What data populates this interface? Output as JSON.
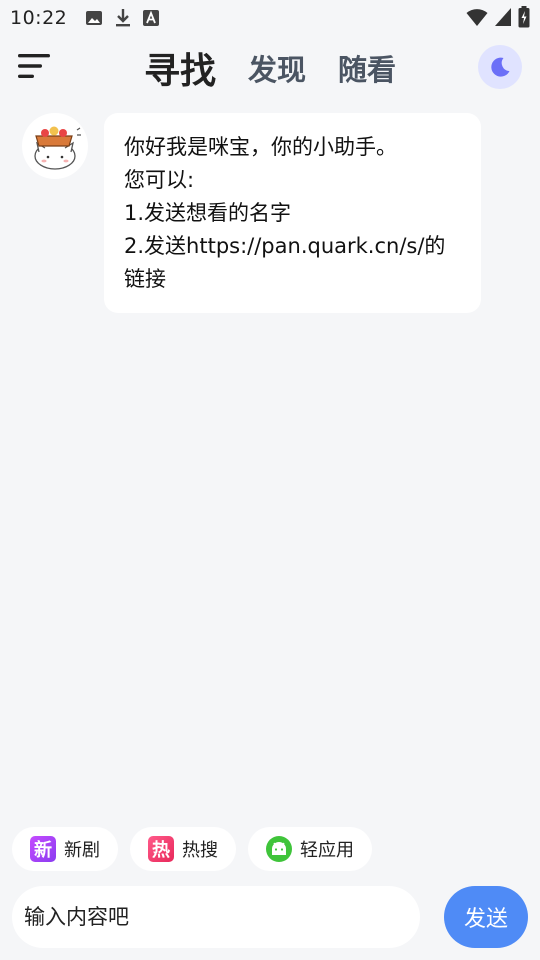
{
  "status_bar": {
    "time": "10:22",
    "left_icons": [
      "image-icon",
      "download-icon",
      "text-a-icon"
    ],
    "right_icons": [
      "wifi-icon",
      "signal-icon",
      "battery-icon"
    ]
  },
  "header": {
    "menu_icon": "menu-icon",
    "tabs": [
      {
        "label": "寻找",
        "active": true
      },
      {
        "label": "发现",
        "active": false
      },
      {
        "label": "随看",
        "active": false
      }
    ],
    "theme_icon": "moon-icon"
  },
  "chat": {
    "bot_avatar": "cat-avatar-icon",
    "message_lines": [
      "你好我是咪宝，你的小助手。",
      "您可以:",
      "1.发送想看的名字",
      "2.发送https://pan.quark.cn/s/的链接"
    ]
  },
  "quick_actions": [
    {
      "icon_text": "新",
      "label": "新剧",
      "icon": "new-icon"
    },
    {
      "icon_text": "热",
      "label": "热搜",
      "icon": "hot-icon"
    },
    {
      "icon_text": "",
      "label": "轻应用",
      "icon": "android-icon"
    }
  ],
  "composer": {
    "placeholder": "输入内容吧",
    "send_label": "发送"
  },
  "colors": {
    "background": "#f5f6f8",
    "accent": "#4f8bf6",
    "moon_bg": "#e0e3ff",
    "moon": "#6b6ff7"
  }
}
